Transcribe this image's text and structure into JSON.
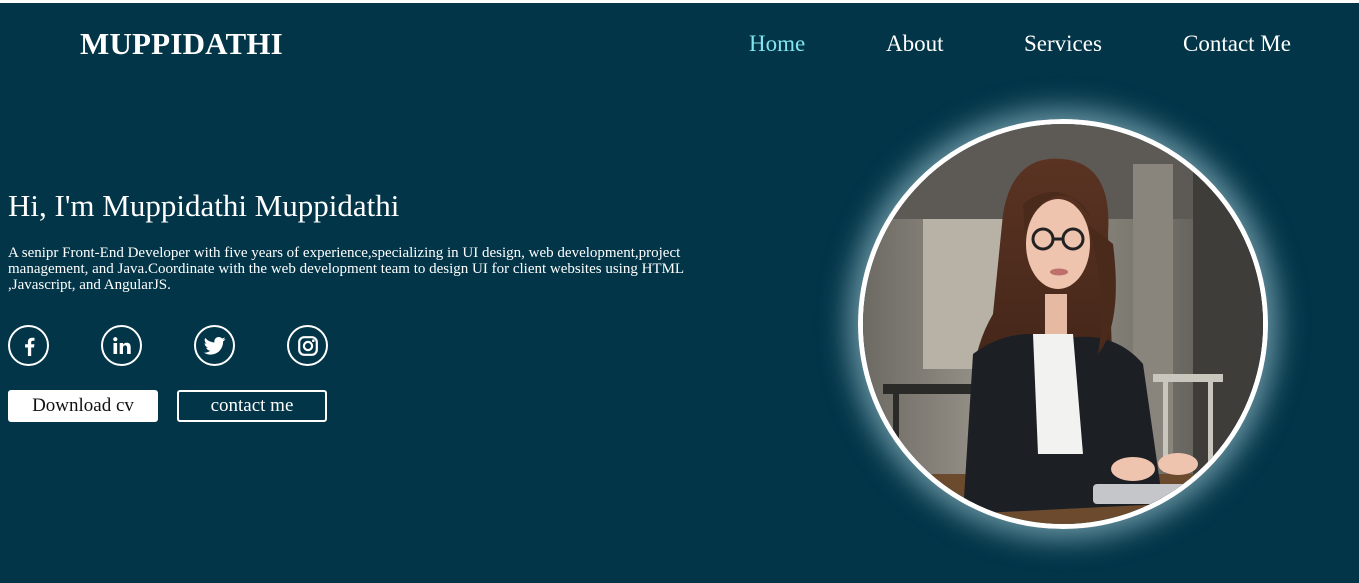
{
  "brand": {
    "logo": "MUPPIDATHI"
  },
  "nav": {
    "items": [
      {
        "label": "Home",
        "active": true
      },
      {
        "label": "About",
        "active": false
      },
      {
        "label": "Services",
        "active": false
      },
      {
        "label": "Contact Me",
        "active": false
      }
    ]
  },
  "hero": {
    "title": "Hi, I'm Muppidathi Muppidathi",
    "description": "A senipr Front-End Developer with five years of experience,specializing in UI design, web development,project management, and Java.Coordinate with the web development team to design UI for client websites using HTML ,Javascript, and AngularJS.",
    "socials": [
      {
        "icon": "facebook-icon",
        "glyph": "f"
      },
      {
        "icon": "linkedin-icon",
        "glyph": "in"
      },
      {
        "icon": "twitter-icon",
        "glyph": ""
      },
      {
        "icon": "instagram-icon",
        "glyph": ""
      }
    ],
    "buttons": {
      "download_cv": "Download cv",
      "contact_me": "contact me"
    },
    "photo": {
      "icon": "profile-photo"
    }
  },
  "colors": {
    "background": "#023548",
    "accent": "#7fe7ef",
    "text": "#ffffff"
  }
}
